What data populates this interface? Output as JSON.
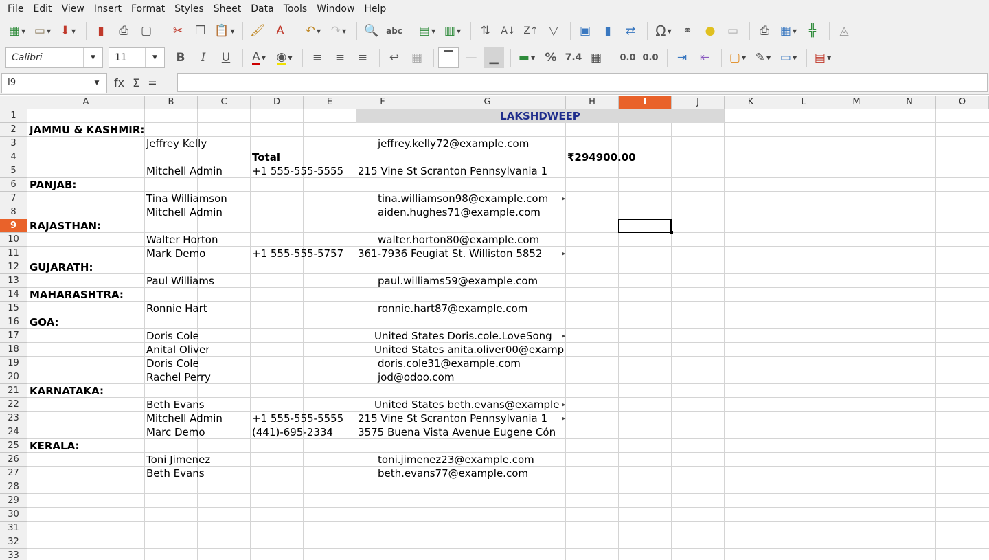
{
  "menu": [
    "File",
    "Edit",
    "View",
    "Insert",
    "Format",
    "Styles",
    "Sheet",
    "Data",
    "Tools",
    "Window",
    "Help"
  ],
  "font": {
    "name": "Calibri",
    "size": "11"
  },
  "name_box": "I9",
  "formula_icons": {
    "function": "fx",
    "sum": "Σ",
    "equals": "="
  },
  "columns": [
    "A",
    "B",
    "C",
    "D",
    "E",
    "F",
    "G",
    "H",
    "I",
    "J",
    "K",
    "L",
    "M",
    "N",
    "O"
  ],
  "rows": [
    "1",
    "2",
    "3",
    "4",
    "5",
    "6",
    "7",
    "8",
    "9",
    "10",
    "11",
    "12",
    "13",
    "14",
    "15",
    "16",
    "17",
    "18",
    "19",
    "20",
    "21",
    "22",
    "23",
    "24",
    "25",
    "26",
    "27",
    "28",
    "29",
    "30",
    "31",
    "32",
    "33"
  ],
  "selected_column": "I",
  "selected_row": "9",
  "sheet": {
    "title": "LAKSHDWEEP",
    "state_j_k": "JAMMU & KASHMIR:",
    "r3_name": "Jeffrey Kelly",
    "r3_email": "jeffrey.kelly72@example.com",
    "r4_total_label": "Total",
    "r4_total_value": "₹294900.00",
    "r5_name": "Mitchell Admin",
    "r5_phone": "+1 555-555-5555",
    "r5_address": "215 Vine St  Scranton Pennsylvania 1",
    "state_panjab": "PANJAB:",
    "r7_name": "Tina Williamson",
    "r7_email": "tina.williamson98@example.com",
    "r8_name": "Mitchell Admin",
    "r8_email": "aiden.hughes71@example.com",
    "state_rajasthan": "RAJASTHAN:",
    "r10_name": "Walter Horton",
    "r10_email": "walter.horton80@example.com",
    "r11_name": "Mark Demo",
    "r11_phone": "+1 555-555-5757",
    "r11_address": "361-7936 Feugiat St.  Williston  5852",
    "state_gujarath": "GUJARATH:",
    "r13_name": "Paul Williams",
    "r13_email": "paul.williams59@example.com",
    "state_maharashtra": "MAHARASHTRA:",
    "r15_name": "Ronnie Hart",
    "r15_email": "ronnie.hart87@example.com",
    "state_goa": "GOA:",
    "r17_name": "Doris Cole",
    "r17_email": "United States Doris.cole.LoveSong",
    "r18_name": "Anital Oliver",
    "r18_email": "United States anita.oliver00@examp",
    "r19_name": "Doris Cole",
    "r19_email": "doris.cole31@example.com",
    "r20_name": "Rachel Perry",
    "r20_email": "jod@odoo.com",
    "state_karnataka": "KARNATAKA:",
    "r22_name": "Beth Evans",
    "r22_email": "United States beth.evans@example",
    "r23_name": "Mitchell Admin",
    "r23_phone": "+1 555-555-5555",
    "r23_address": "215 Vine St  Scranton Pennsylvania 1",
    "r24_name": "Marc Demo",
    "r24_phone": "(441)-695-2334",
    "r24_address": "3575  Buena Vista Avenue  Eugene Cón",
    "state_kerala": "KERALA:",
    "r26_name": "Toni Jimenez",
    "r26_email": "toni.jimenez23@example.com",
    "r27_name": "Beth Evans",
    "r27_email": "beth.evans77@example.com"
  },
  "colors": {
    "selection": "#e9622a",
    "title_fill": "#d9d9d9",
    "title_text": "#1f2d8c"
  }
}
